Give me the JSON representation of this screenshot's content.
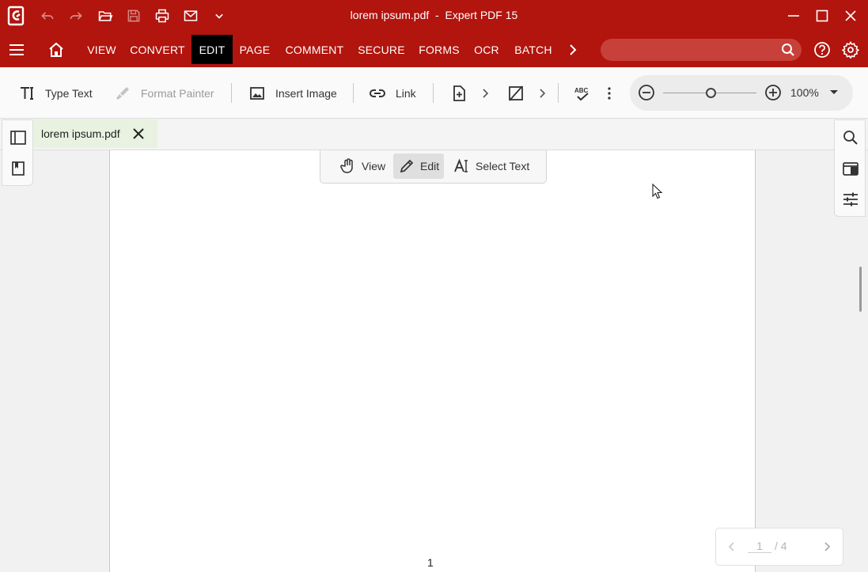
{
  "window": {
    "title": "lorem ipsum.pdf  -  Expert PDF 15"
  },
  "quick_access": [
    "undo-icon",
    "redo-icon",
    "open-folder-icon",
    "save-icon",
    "print-icon",
    "email-icon",
    "chevron-down-icon"
  ],
  "menu": {
    "items": [
      "VIEW",
      "CONVERT",
      "EDIT",
      "PAGE",
      "COMMENT",
      "SECURE",
      "FORMS",
      "OCR",
      "BATCH"
    ],
    "active": "EDIT",
    "search_placeholder": ""
  },
  "toolbar": {
    "type_text": "Type Text",
    "format_painter": "Format Painter",
    "insert_image": "Insert Image",
    "link": "Link",
    "zoom": "100%"
  },
  "document": {
    "tab_name": "lorem ipsum.pdf",
    "page_label": "1"
  },
  "modes": {
    "view": "View",
    "edit": "Edit",
    "select_text": "Select Text",
    "active": "Edit"
  },
  "pagenav": {
    "current": "1",
    "total": "/ 4"
  },
  "colors": {
    "brand_red": "#b2140e",
    "active_menu": "#000000",
    "tab_bg": "#e9f2e0"
  }
}
